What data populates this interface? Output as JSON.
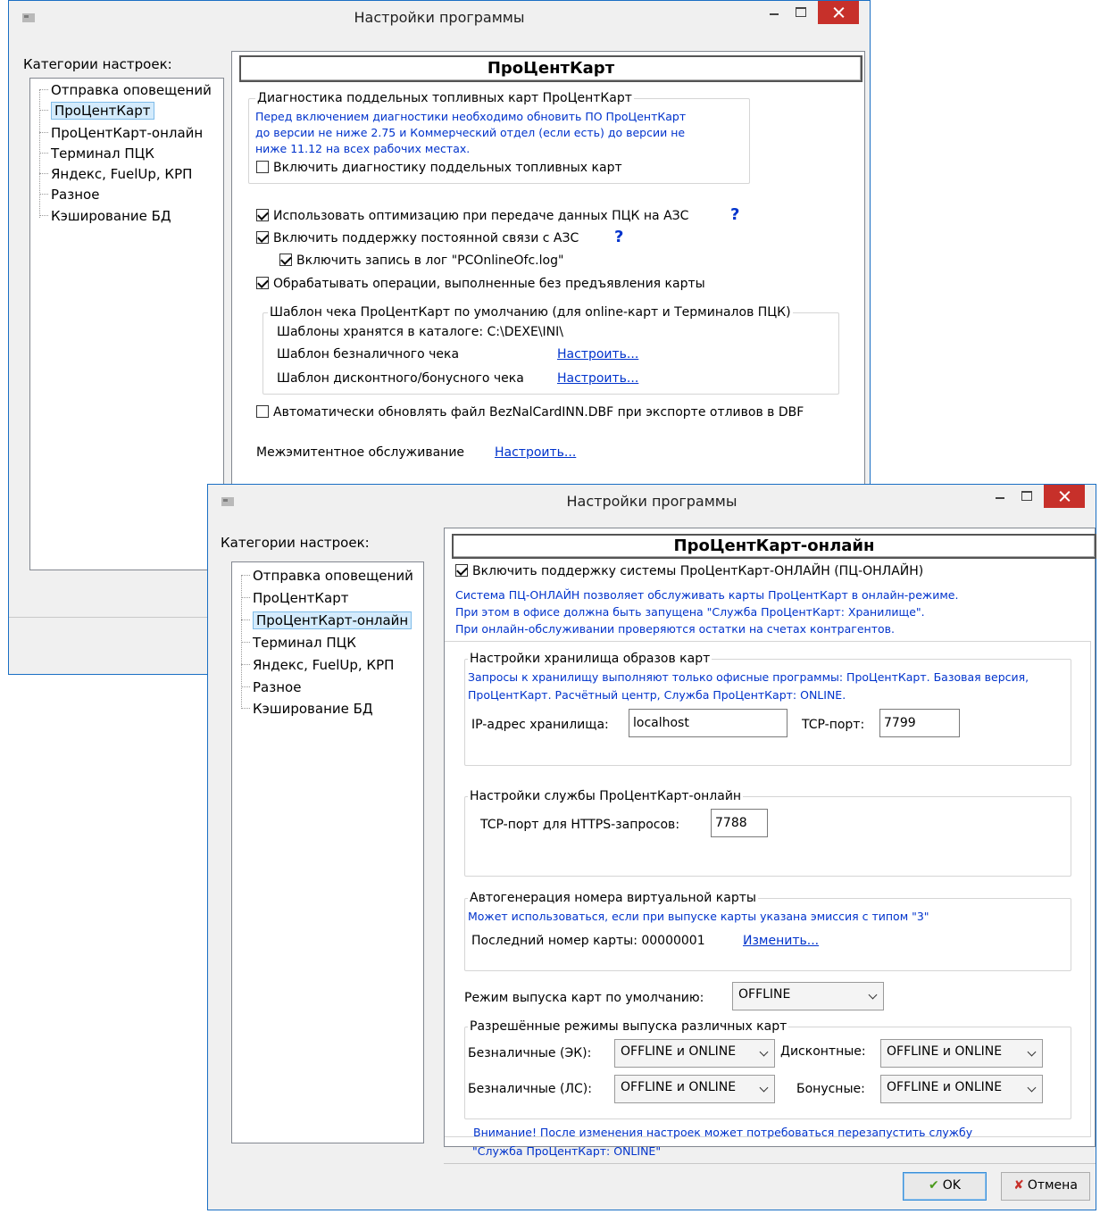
{
  "window_back": {
    "title": "Настройки программы",
    "categories_label": "Категории настроек:",
    "categories": [
      "Отправка оповещений",
      "ПроЦентКарт",
      "ПроЦентКарт-онлайн",
      "Терминал ПЦК",
      "Яндекс, FuelUp, КРП",
      "Разное",
      "Кэширование БД"
    ],
    "selected_category": "ПроЦентКарт",
    "panel_title": "ПроЦентКарт",
    "diag_group_title": "Диагностика поддельных топливных карт ПроЦентКарт",
    "diag_note": [
      "Перед включением диагностики необходимо обновить ПО ПроЦентКарт",
      "до версии не ниже 2.75 и Коммерческий отдел (если есть) до версии не",
      "ниже 11.12 на всех рабочих местах."
    ],
    "diag_checkbox": "Включить диагностику поддельных топливных карт",
    "opt_checkbox": "Использовать оптимизацию при передаче данных ПЦК на АЗС",
    "link_checkbox": "Включить поддержку постоянной связи с АЗС",
    "log_checkbox": "Включить запись в лог \"PCOnlineOfc.log\"",
    "nocard_checkbox": "Обрабатывать операции, выполненные без предъявления карты",
    "template_group_title": "Шаблон чека ПроЦентКарт по умолчанию (для online-карт и Терминалов ПЦК)",
    "template_dir": "Шаблоны хранятся в каталоге: C:\\DEXE\\INI\\",
    "template_cashless": "Шаблон безналичного чека",
    "template_discount": "Шаблон дисконтного/бонусного чека",
    "setup_link": "Настроить...",
    "auto_update_checkbox": "Автоматически обновлять файл  BezNalCardINN.DBF при экспорте отливов в DBF",
    "interissuer_label": "Межэмитентное обслуживание",
    "help_mark": "?"
  },
  "window_front": {
    "title": "Настройки программы",
    "categories_label": "Категории настроек:",
    "categories": [
      "Отправка оповещений",
      "ПроЦентКарт",
      "ПроЦентКарт-онлайн",
      "Терминал ПЦК",
      "Яндекс, FuelUp, КРП",
      "Разное",
      "Кэширование БД"
    ],
    "selected_category": "ПроЦентКарт-онлайн",
    "panel_title": "ПроЦентКарт-онлайн",
    "online_checkbox": "Включить поддержку системы ПроЦентКарт-ОНЛАЙН (ПЦ-ОНЛАЙН)",
    "online_note": [
      "Система ПЦ-ОНЛАЙН позволяет обслуживать карты ПроЦентКарт в онлайн-режиме.",
      "При этом в офисе должна быть запущена \"Служба ПроЦентКарт: Хранилище\".",
      "При онлайн-обслуживании проверяются остатки на счетах контрагентов."
    ],
    "storage_group_title": "Настройки хранилища образов карт",
    "storage_note": [
      "Запросы к хранилищу выполняют только офисные программы: ПроЦентКарт. Базовая версия,",
      "ПроЦентКарт. Расчётный центр, Служба ПроЦентКарт: ONLINE."
    ],
    "ip_label": "IP-адрес хранилища:",
    "ip_value": "localhost",
    "tcp_label": "TCP-порт:",
    "tcp_value": "7799",
    "service_group_title": "Настройки службы ПроЦентКарт-онлайн",
    "https_label": "TCP-порт для HTTPS-запросов:",
    "https_value": "7788",
    "autogen_group_title": "Автогенерация номера виртуальной карты",
    "autogen_note": "Может использоваться, если при выпуске карты указана эмиссия с типом \"3\"",
    "last_card_label": "Последний номер карты: 00000001",
    "change_link": "Изменить...",
    "issue_mode_label": "Режим выпуска карт по умолчанию:",
    "issue_mode_value": "OFFLINE",
    "allowed_group_title": "Разрешённые режимы выпуска различных карт",
    "cashless_ek_label": "Безналичные (ЭК):",
    "cashless_ek_value": "OFFLINE и ONLINE",
    "discount_label": "Дисконтные:",
    "discount_value": "OFFLINE и ONLINE",
    "cashless_ls_label": "Безналичные (ЛС):",
    "cashless_ls_value": "OFFLINE и ONLINE",
    "bonus_label": "Бонусные:",
    "bonus_value": "OFFLINE и ONLINE",
    "warning": [
      "Внимание! После изменения настроек может потребоваться перезапустить службу",
      "\"Служба ПроЦентКарт: ONLINE\""
    ],
    "ok_label": "OK",
    "cancel_label": "Отмена"
  },
  "colors": {
    "accent": "#1a6fc4",
    "close": "#c7302a",
    "link": "#0033cc",
    "selection": "#d4ebfc"
  }
}
